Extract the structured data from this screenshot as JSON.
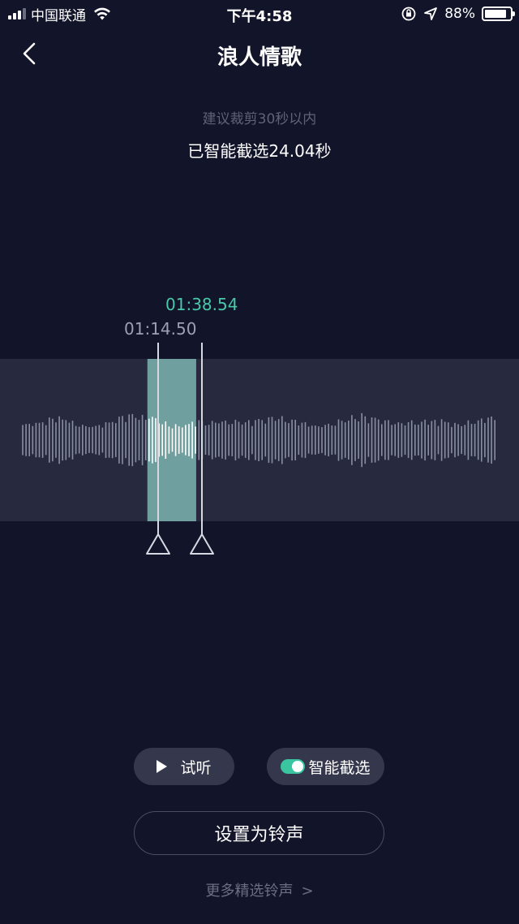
{
  "status_bar": {
    "carrier": "中国联通",
    "time": "下午4:58",
    "battery_percent": "88%",
    "battery_level": 0.88,
    "signal_bars": 4,
    "signal_active": 3
  },
  "nav": {
    "title": "浪人情歌"
  },
  "trim": {
    "hint": "建议裁剪30秒以内",
    "selected_info": "已智能截选24.04秒",
    "start_time": "01:14.50",
    "end_time": "01:38.54",
    "selection_start_fraction": 0.284,
    "selection_end_fraction": 0.378
  },
  "colors": {
    "background": "#12142a",
    "accent": "#48c9a8",
    "band": "#272a3e",
    "selection": "#6f9f9e"
  },
  "controls": {
    "preview_label": "试听",
    "smart_select_label": "智能截选",
    "smart_select_on": true,
    "set_ringtone_label": "设置为铃声",
    "more_label": "更多精选铃声",
    "more_chevron": ">"
  },
  "icons": {
    "back": "chevron-left-icon",
    "play": "play-icon",
    "wifi": "wifi-icon",
    "lock": "rotation-lock-icon",
    "location": "location-arrow-icon",
    "battery": "battery-icon"
  }
}
